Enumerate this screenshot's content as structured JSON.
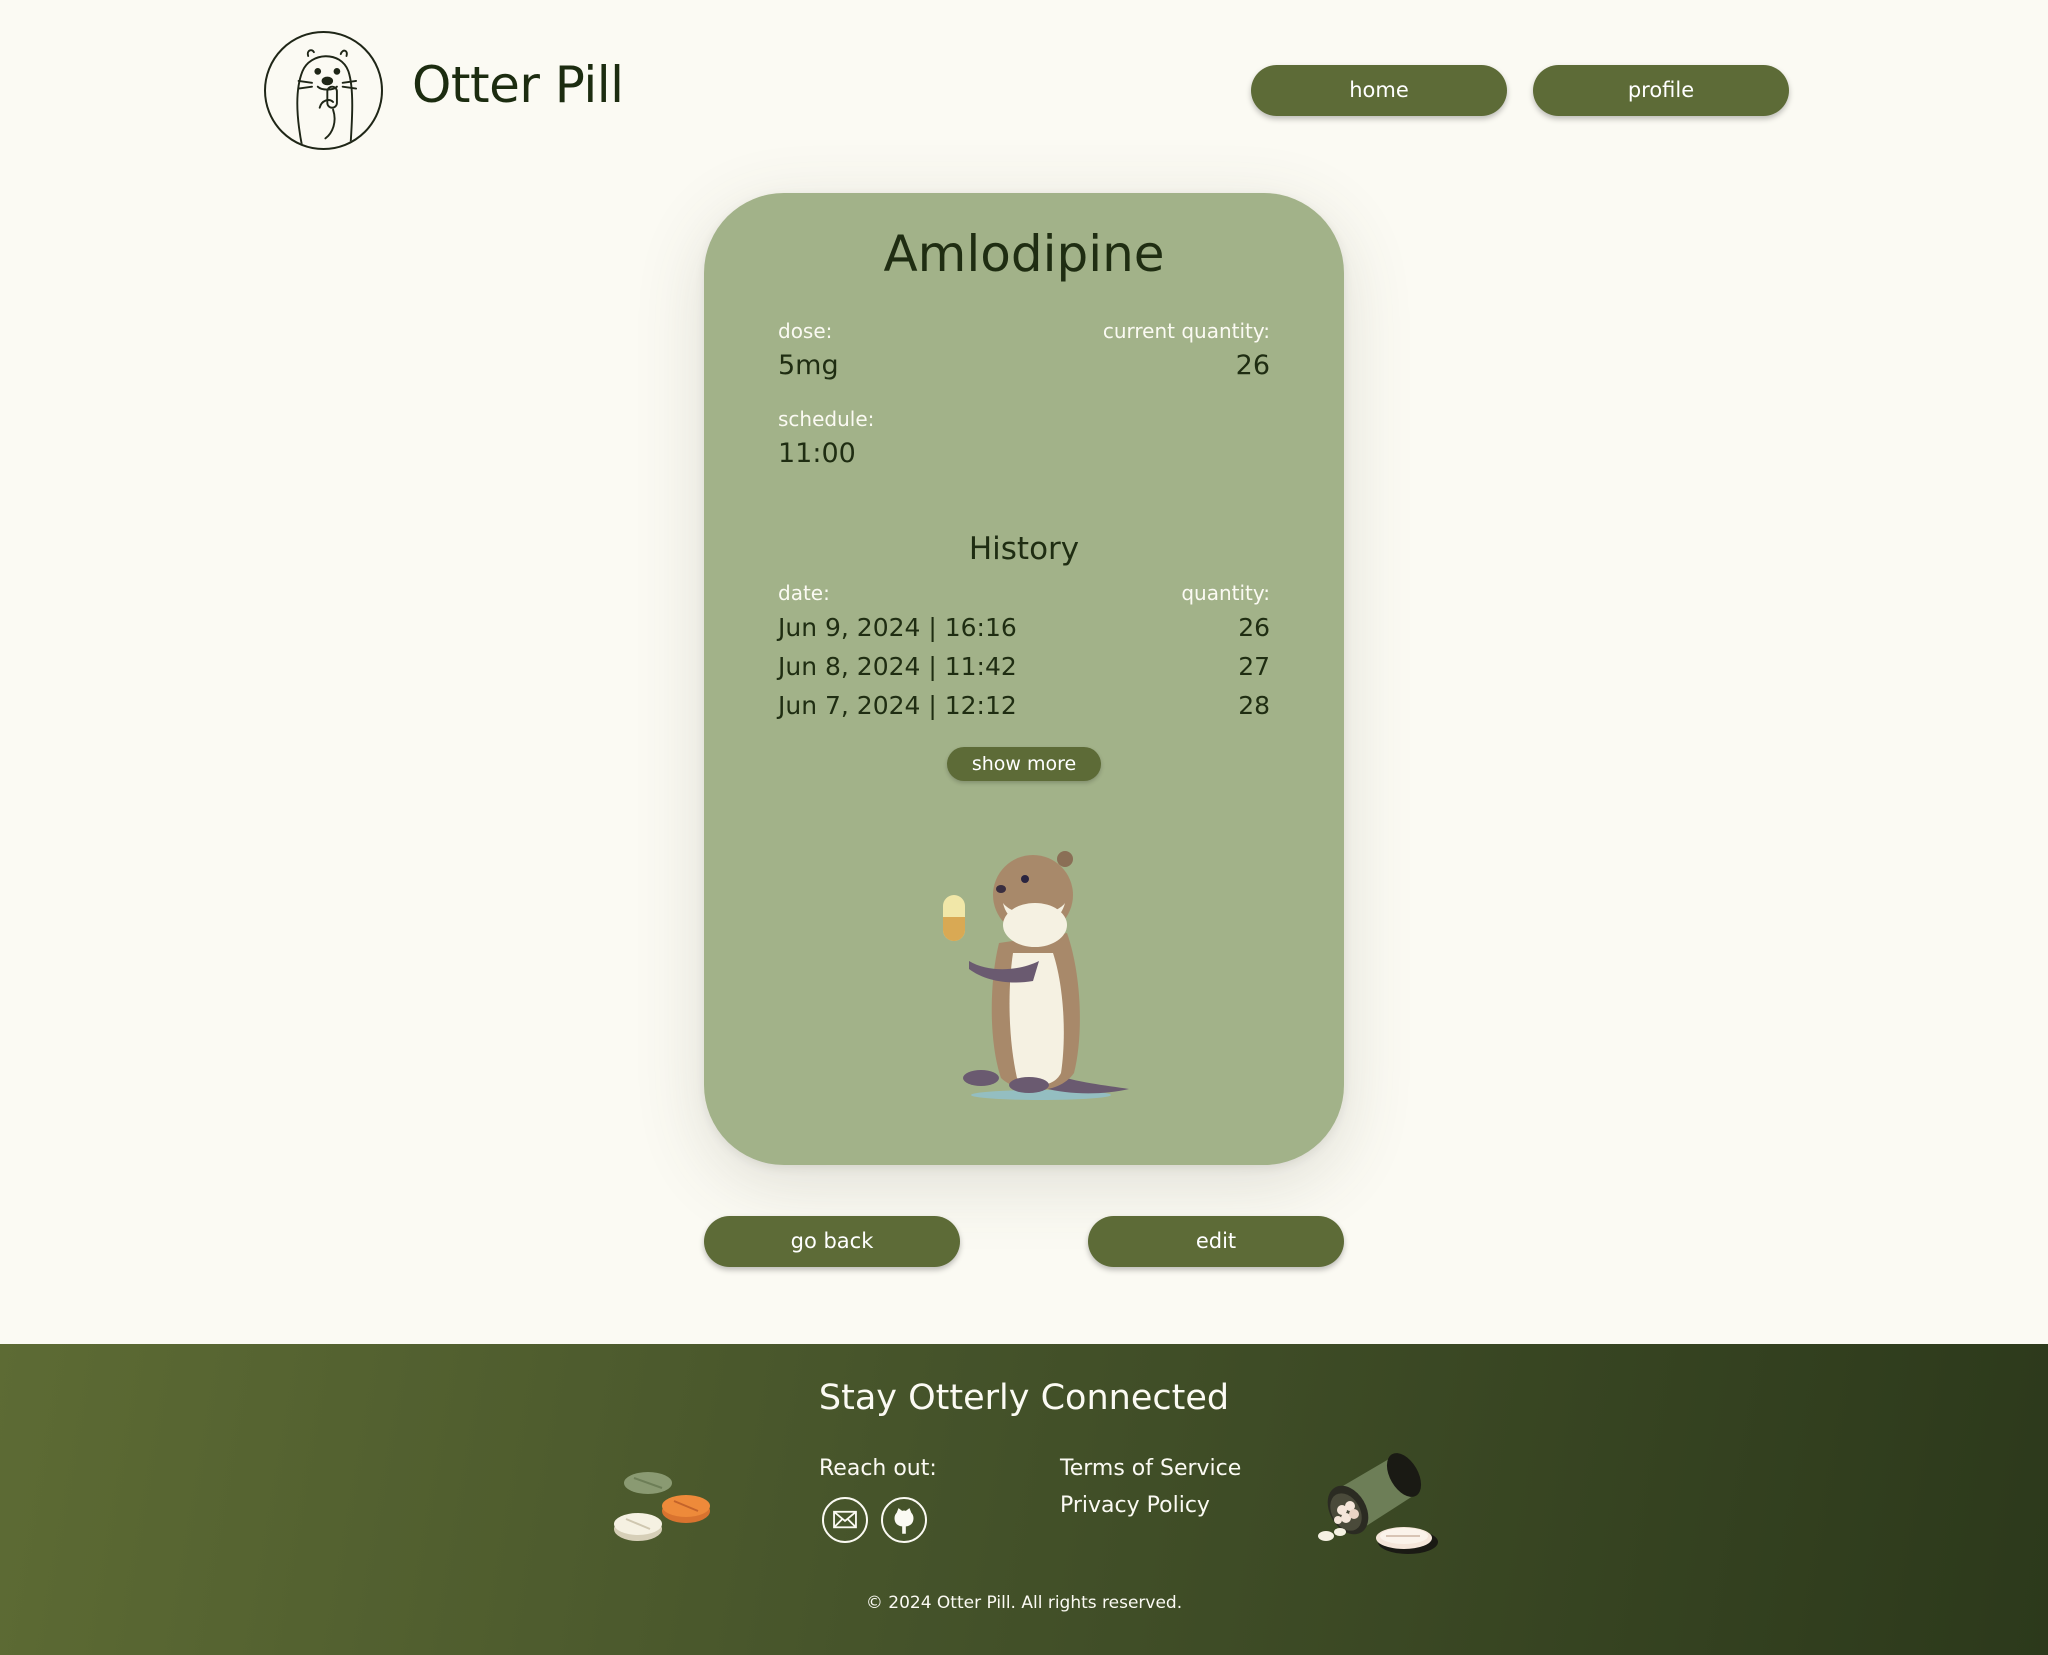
{
  "header": {
    "brand": "Otter Pill",
    "nav": {
      "home": "home",
      "profile": "profile"
    }
  },
  "medication": {
    "name": "Amlodipine",
    "dose_label": "dose:",
    "dose": "5mg",
    "quantity_label": "current quantity:",
    "quantity": "26",
    "schedule_label": "schedule:",
    "schedule": "11:00"
  },
  "history": {
    "title": "History",
    "date_header": "date:",
    "quantity_header": "quantity:",
    "rows": [
      {
        "date": "Jun 9, 2024 | 16:16",
        "quantity": "26"
      },
      {
        "date": "Jun 8, 2024 | 11:42",
        "quantity": "27"
      },
      {
        "date": "Jun 7, 2024 | 12:12",
        "quantity": "28"
      }
    ],
    "show_more": "show more"
  },
  "actions": {
    "go_back": "go back",
    "edit": "edit"
  },
  "footer": {
    "title": "Stay Otterly Connected",
    "reach_out": "Reach out:",
    "icons": [
      "email-icon",
      "github-icon"
    ],
    "terms": "Terms of Service",
    "privacy": "Privacy Policy",
    "copyright": "© 2024 Otter Pill. All rights reserved."
  },
  "colors": {
    "background": "#fbfaf3",
    "card": "#a2b289",
    "button": "#5d6b37",
    "text_dark": "#1f2d12",
    "footer_start": "#5d6b34",
    "footer_end": "#2c391b"
  }
}
